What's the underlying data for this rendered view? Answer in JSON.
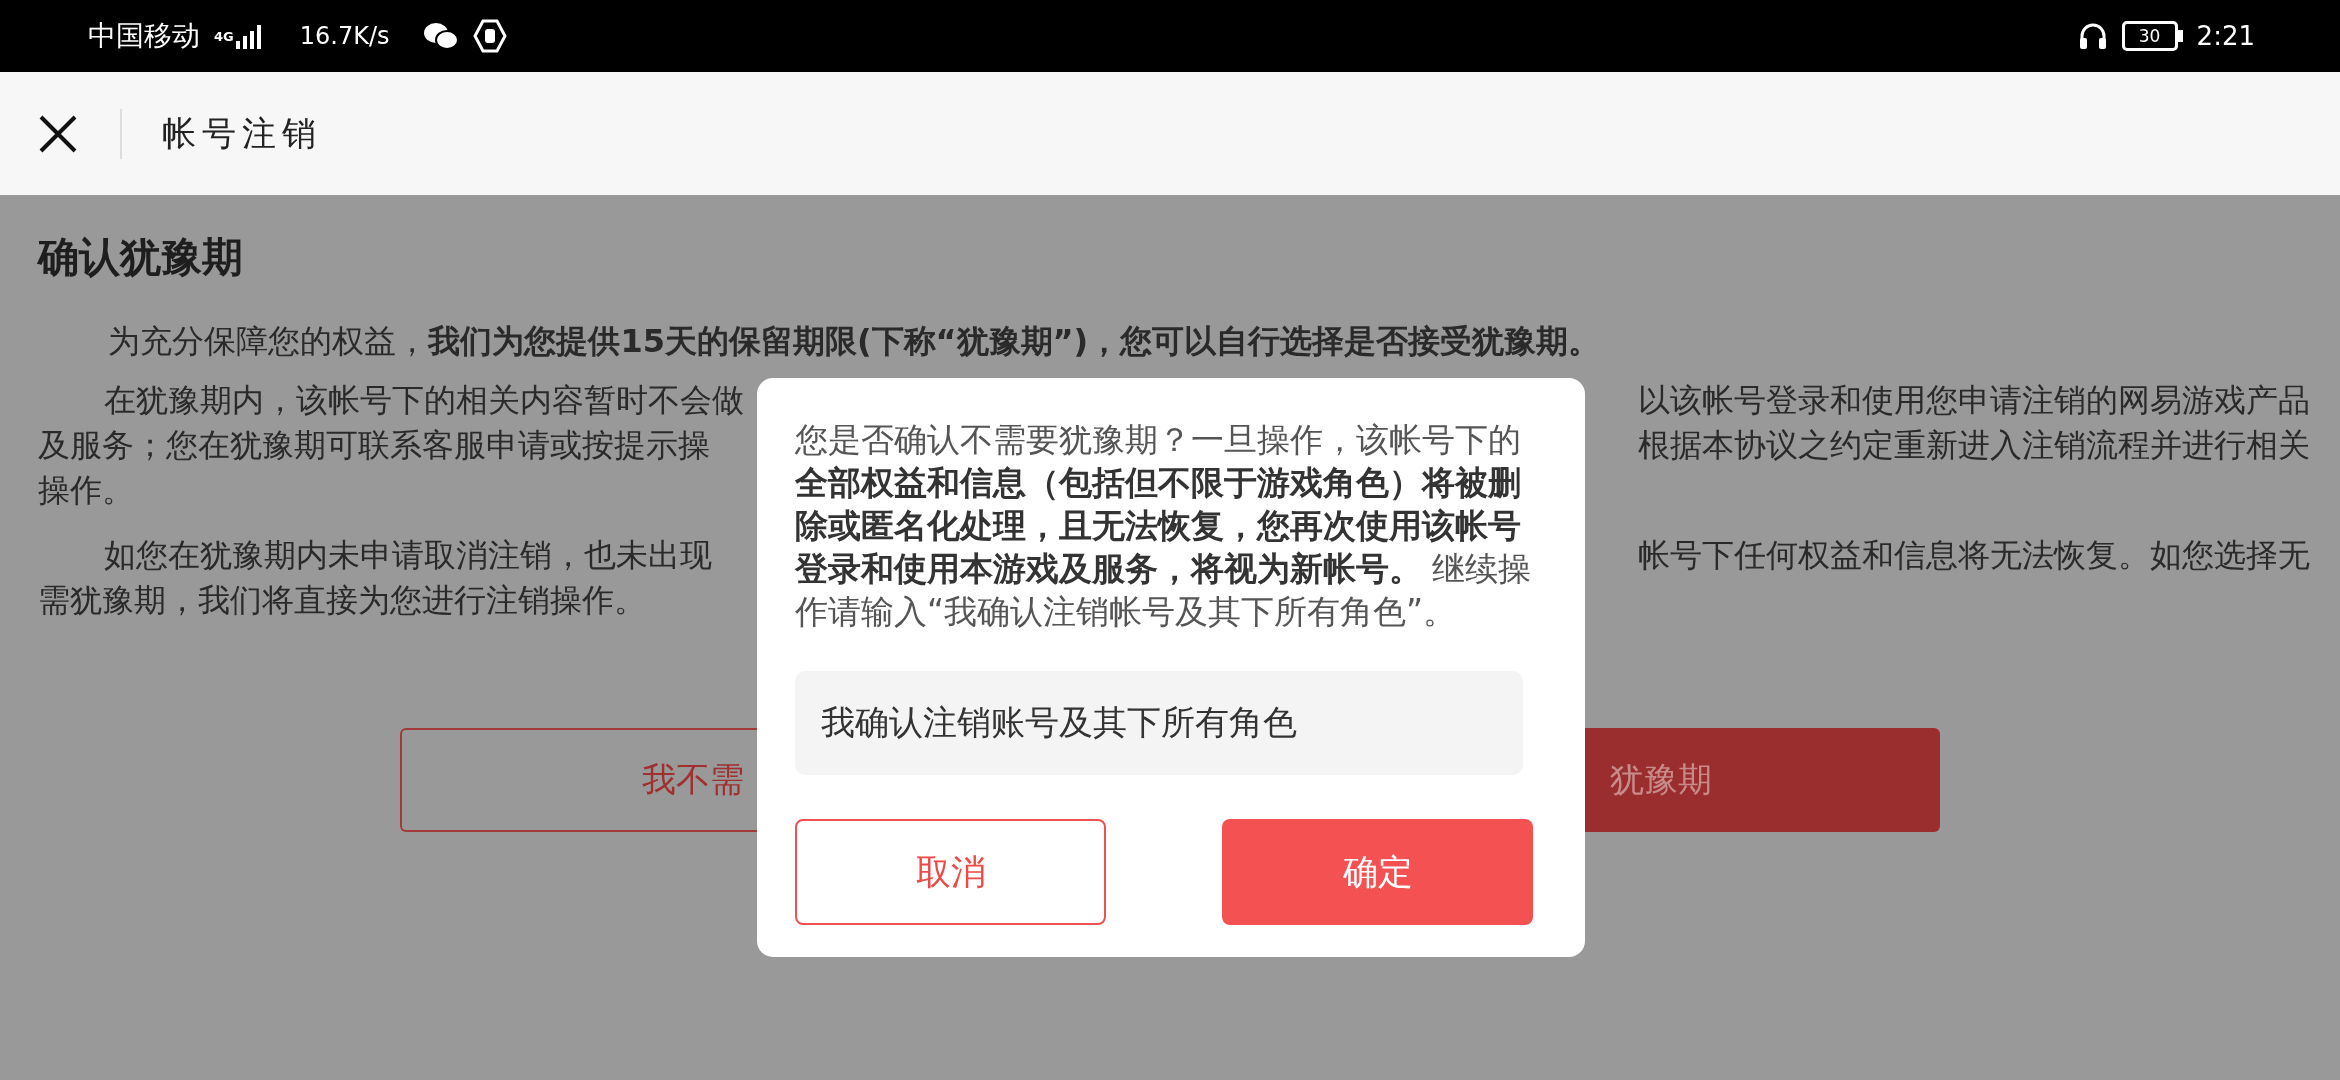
{
  "status_bar": {
    "carrier": "中国移动",
    "network": "4G",
    "speed": "16.7K/s",
    "battery": "30",
    "time": "2:21"
  },
  "header": {
    "title": "帐号注销"
  },
  "page": {
    "heading": "确认犹豫期",
    "intro": "为充分保障您的权益，**我们为您提供15天的保留期限(下称“犹豫期”)，您可以自行选择是否接受犹豫期。**",
    "paragraphs": [
      [
        {
          "left": "在犹豫期内，该帐号下的相关内容暂时不会做",
          "right": "以该帐号登录和使用您申请注销的网易游戏产品"
        },
        {
          "left": "及服务；您在犹豫期可联系客服申请或按提示操",
          "right": "根据本协议之约定重新进入注销流程并进行相关"
        },
        {
          "left": "操作。"
        }
      ],
      [
        {
          "left": "如您在犹豫期内未申请取消注销，也未出现",
          "right": "帐号下任何权益和信息将无法恢复。如您选择无"
        },
        {
          "left": "需犹豫期，我们将直接为您进行注销操作。"
        }
      ]
    ],
    "buttons": [
      {
        "label": "我不需",
        "kind": "outline"
      },
      {
        "label": "犹豫期",
        "kind": "filled"
      }
    ]
  },
  "dialog": {
    "message": "您是否确认不需要犹豫期？一旦操作，该帐号下的**全部权益和信息（包括但不限于游戏角色）将被删除或匿名化处理，且无法恢复，您再次使用该帐号登录和使用本游戏及服务，将视为新帐号。** 继续操作请输入“我确认注销帐号及其下所有角色”。",
    "input": {
      "value": "我确认注销账号及其下所有角色"
    },
    "buttons": [
      {
        "label": "取消",
        "kind": "outline"
      },
      {
        "label": "确定",
        "kind": "filled"
      }
    ]
  }
}
